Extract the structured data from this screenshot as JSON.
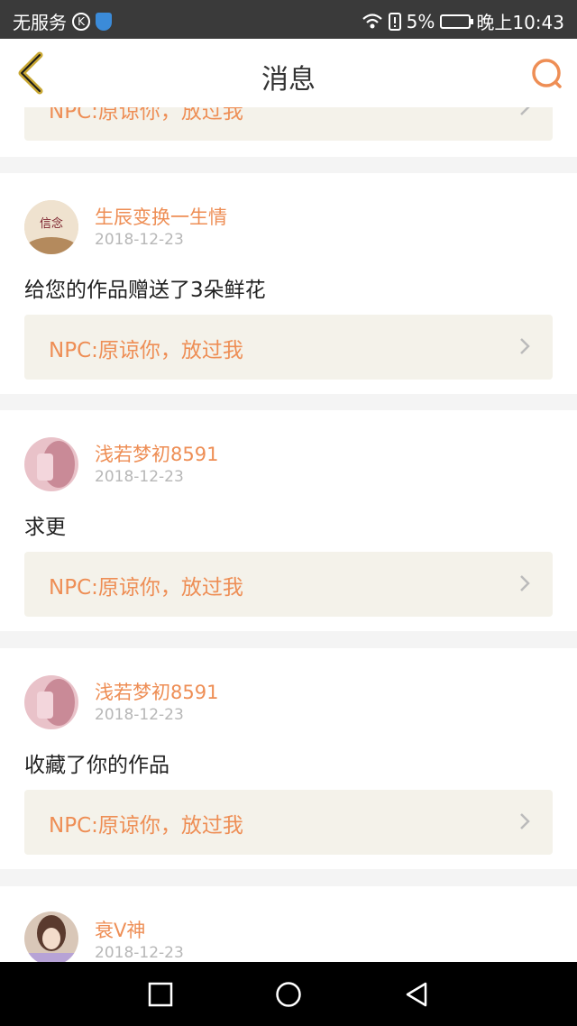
{
  "statusbar": {
    "carrier": "无服务",
    "k_badge": "K",
    "battery_percent": "5%",
    "time": "晚上10:43"
  },
  "header": {
    "title": "消息"
  },
  "npc_label": "NPC:原谅你，放过我",
  "messages": [
    {
      "user": "生辰变换一生情",
      "date": "2018-12-23",
      "text": "给您的作品赠送了3朵鲜花",
      "avatar_text": "信念"
    },
    {
      "user": "浅若梦初8591",
      "date": "2018-12-23",
      "text": "求更"
    },
    {
      "user": "浅若梦初8591",
      "date": "2018-12-23",
      "text": "收藏了你的作品"
    },
    {
      "user": "衰V神",
      "date": "2018-12-23"
    }
  ],
  "colors": {
    "accent": "#ee8e55",
    "back_arrow": "#c8a733",
    "npc_box": "#f4f2ea"
  }
}
